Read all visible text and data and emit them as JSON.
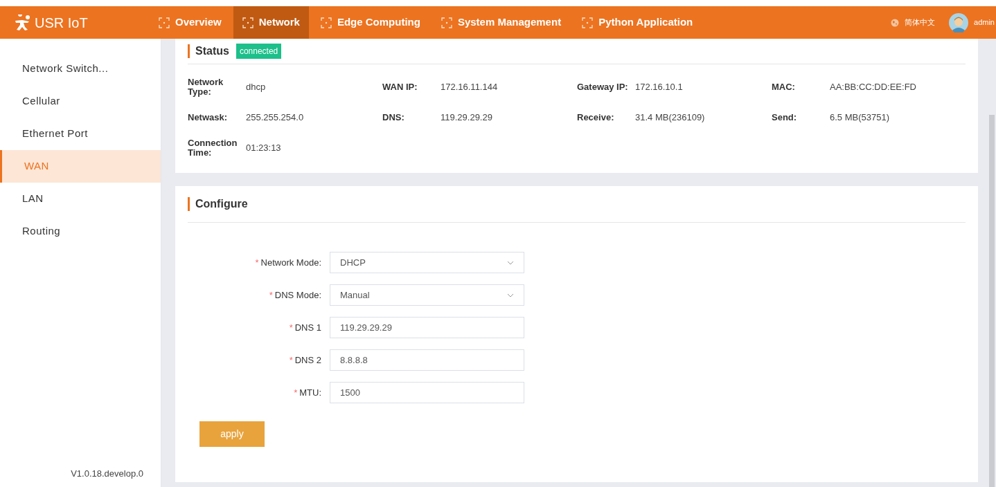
{
  "header": {
    "logo": "USR IoT",
    "nav": [
      {
        "label": "Overview",
        "selected": false
      },
      {
        "label": "Network",
        "selected": true
      },
      {
        "label": "Edge Computing",
        "selected": false
      },
      {
        "label": "System Management",
        "selected": false
      },
      {
        "label": "Python Application",
        "selected": false
      }
    ],
    "language": "简体中文",
    "user": "admin"
  },
  "sidebar": {
    "items": [
      {
        "label": "Network Switch...",
        "selected": false
      },
      {
        "label": "Cellular",
        "selected": false
      },
      {
        "label": "Ethernet Port",
        "selected": false
      },
      {
        "label": "WAN",
        "selected": true
      },
      {
        "label": "LAN",
        "selected": false
      },
      {
        "label": "Routing",
        "selected": false
      }
    ],
    "version": "V1.0.18.develop.0"
  },
  "status": {
    "title": "Status",
    "badge": "connected",
    "fields": [
      {
        "label": "Network Type:",
        "value": "dhcp"
      },
      {
        "label": "WAN IP:",
        "value": "172.16.11.144"
      },
      {
        "label": "Gateway IP:",
        "value": "172.16.10.1"
      },
      {
        "label": "MAC:",
        "value": "AA:BB:CC:DD:EE:FD"
      },
      {
        "label": "Netwask:",
        "value": "255.255.254.0"
      },
      {
        "label": "DNS:",
        "value": "119.29.29.29"
      },
      {
        "label": "Receive:",
        "value": "31.4 MB(236109)"
      },
      {
        "label": "Send:",
        "value": "6.5 MB(53751)"
      },
      {
        "label": "Connection Time:",
        "value": "01:23:13"
      }
    ]
  },
  "configure": {
    "title": "Configure",
    "fields": [
      {
        "kind": "select",
        "required_mark": "*",
        "label": "Network Mode:",
        "value": "DHCP"
      },
      {
        "kind": "select",
        "required_mark": "*",
        "label": "DNS Mode:",
        "value": "Manual"
      },
      {
        "kind": "input",
        "required_mark": "*",
        "label": "DNS 1",
        "value": "119.29.29.29"
      },
      {
        "kind": "input",
        "required_mark": "*",
        "label": "DNS 2",
        "value": "8.8.8.8"
      },
      {
        "kind": "input",
        "required_mark": "*",
        "label": "MTU:",
        "value": "1500"
      }
    ],
    "button": "apply"
  }
}
